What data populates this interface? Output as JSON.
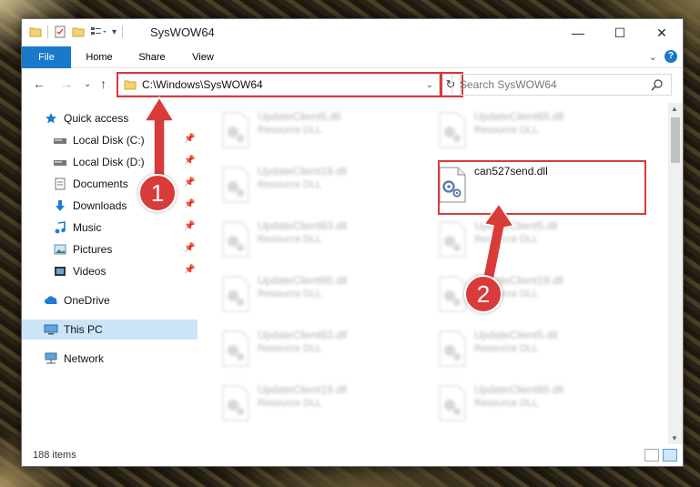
{
  "window": {
    "title": "SysWOW64",
    "controls": {
      "minimize": "—",
      "maximize": "☐",
      "close": "✕"
    }
  },
  "ribbon": {
    "tabs": [
      "File",
      "Home",
      "Share",
      "View"
    ],
    "expand_chevron": "⌄",
    "help": "?"
  },
  "address_bar": {
    "path": "C:\\Windows\\SysWOW64",
    "dropdown": "⌄",
    "refresh": "↻"
  },
  "search": {
    "placeholder": "Search SysWOW64"
  },
  "nav_pane": {
    "items": [
      {
        "label": "Quick access",
        "icon": "star-icon",
        "pinned": false
      },
      {
        "label": "Local Disk (C:)",
        "icon": "drive-icon",
        "pinned": true
      },
      {
        "label": "Local Disk (D:)",
        "icon": "drive-icon",
        "pinned": true
      },
      {
        "label": "Documents",
        "icon": "documents-icon",
        "pinned": true
      },
      {
        "label": "Downloads",
        "icon": "download-icon",
        "pinned": true
      },
      {
        "label": "Music",
        "icon": "music-icon",
        "pinned": true
      },
      {
        "label": "Pictures",
        "icon": "pictures-icon",
        "pinned": true
      },
      {
        "label": "Videos",
        "icon": "videos-icon",
        "pinned": true
      },
      {
        "label": "OneDrive",
        "icon": "cloud-icon",
        "pinned": false
      },
      {
        "label": "This PC",
        "icon": "pc-icon",
        "pinned": false,
        "selected": true
      },
      {
        "label": "Network",
        "icon": "network-icon",
        "pinned": false
      }
    ]
  },
  "files": {
    "left_column": [
      {
        "name": "UpdateClient5.dll",
        "type": "Resource DLL"
      },
      {
        "name": "UpdateClient19.dll",
        "type": "Resource DLL"
      },
      {
        "name": "UpdateClient63.dll",
        "type": "Resource DLL"
      },
      {
        "name": "UpdateClient65.dll",
        "type": "Resource DLL"
      },
      {
        "name": "UpdateClient63.dll",
        "type": "Resource DLL"
      },
      {
        "name": "UpdateClient19.dll",
        "type": "Resource DLL"
      }
    ],
    "right_column": [
      {
        "name": "UpdateClient65.dll",
        "type": "Resource DLL"
      },
      {
        "name": "can527send.dll",
        "type": ""
      },
      {
        "name": "UpdateClient5.dll",
        "type": "Resource DLL"
      },
      {
        "name": "UpdateClient19.dll",
        "type": "Resource DLL"
      },
      {
        "name": "UpdateClient5.dll",
        "type": "Resource DLL"
      },
      {
        "name": "UpdateClient65.dll",
        "type": "Resource DLL"
      }
    ]
  },
  "status_bar": {
    "item_count": "188 items"
  },
  "annotations": {
    "step1": "1",
    "step2": "2",
    "color": "#d93a3a"
  }
}
